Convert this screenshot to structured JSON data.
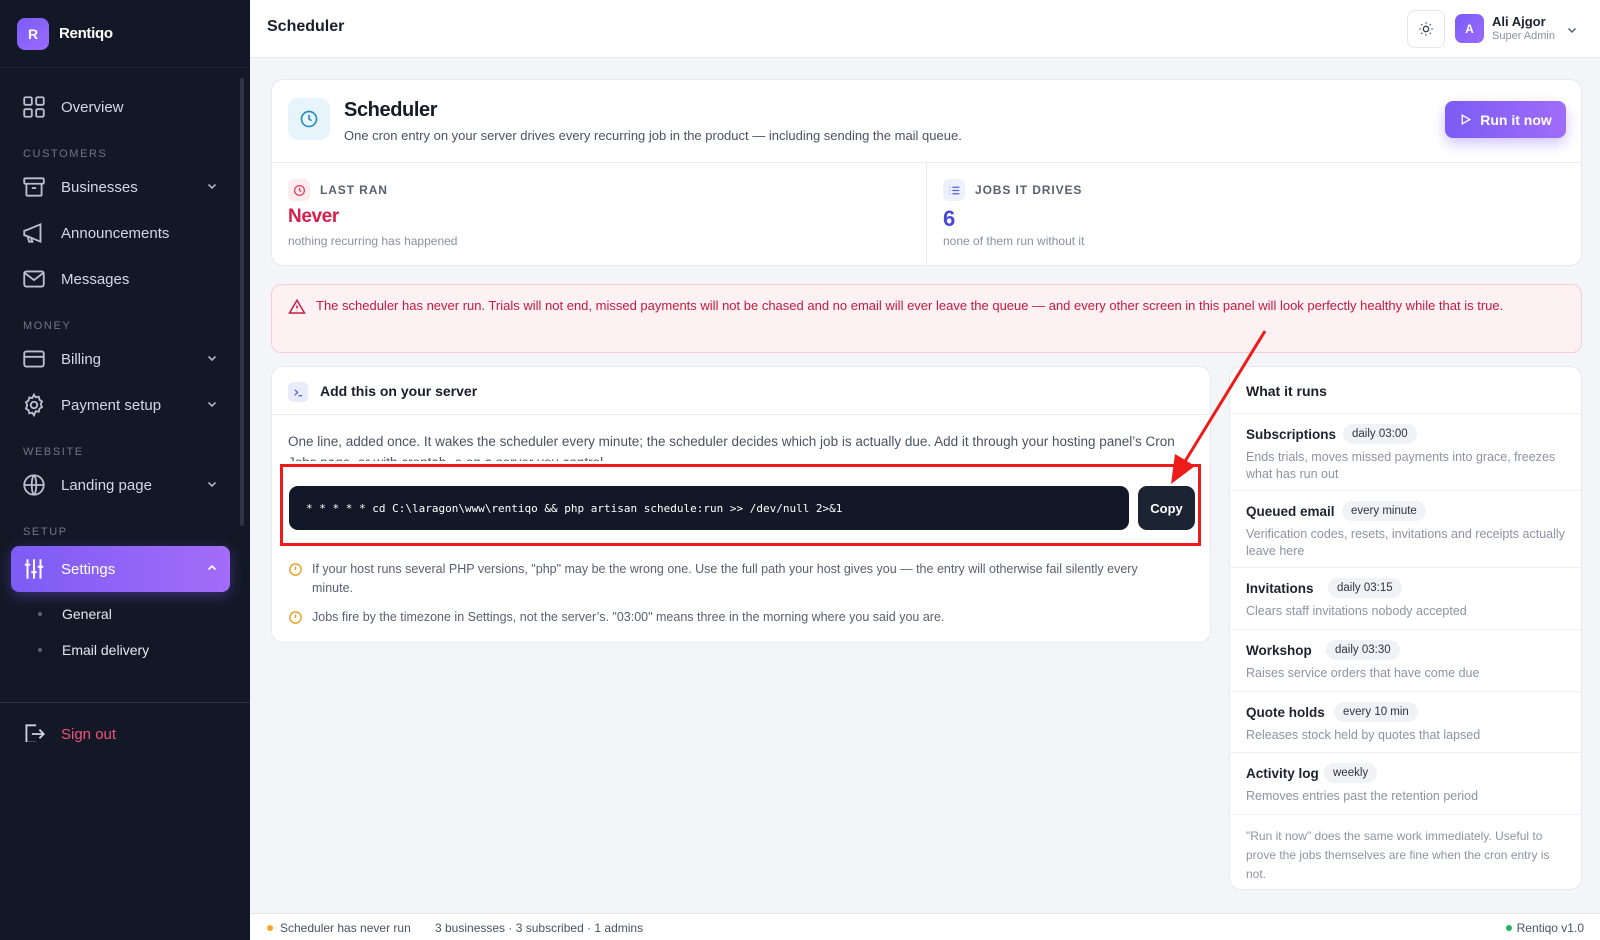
{
  "brand": {
    "logo_letter": "R",
    "name": "Rentiqo"
  },
  "sidebar": {
    "overview": "Overview",
    "sections": {
      "customers": "CUSTOMERS",
      "money": "MONEY",
      "website": "WEBSITE",
      "setup": "SETUP"
    },
    "items": {
      "businesses": "Businesses",
      "announcements": "Announcements",
      "messages": "Messages",
      "billing": "Billing",
      "payment_setup": "Payment setup",
      "landing_page": "Landing page",
      "settings": "Settings"
    },
    "settings_sub": [
      "General",
      "Email delivery"
    ],
    "sign_out": "Sign out"
  },
  "topbar": {
    "title": "Scheduler",
    "user": {
      "initial": "A",
      "name": "Ali Ajgor",
      "role": "Super Admin"
    }
  },
  "header": {
    "title": "Scheduler",
    "subtitle": "One cron entry on your server drives every recurring job in the product — including sending the mail queue.",
    "run_button": "Run it now"
  },
  "stats": {
    "last_ran": {
      "label": "LAST RAN",
      "value": "Never",
      "note": "nothing recurring has happened"
    },
    "jobs": {
      "label": "JOBS IT DRIVES",
      "value": "6",
      "note": "none of them run without it"
    }
  },
  "alert": "The scheduler has never run. Trials will not end, missed payments will not be chased and no email will ever leave the queue — and every other screen in this panel will look perfectly healthy while that is true.",
  "server": {
    "title": "Add this on your server",
    "description": "One line, added once. It wakes the scheduler every minute; the scheduler decides which job is actually due. Add it through your hosting panel’s Cron Jobs page, or with crontab -e on a server you control.",
    "command": "* * * * * cd C:\\laragon\\www\\rentiqo && php artisan schedule:run >> /dev/null 2>&1",
    "copy_label": "Copy",
    "tips": [
      "If your host runs several PHP versions, \"php\" may be the wrong one. Use the full path your host gives you — the entry will otherwise fail silently every minute.",
      "Jobs fire by the timezone in Settings, not the server’s. \"03:00\" means three in the morning where you said you are."
    ]
  },
  "runs": {
    "title": "What it runs",
    "items": [
      {
        "name": "Subscriptions",
        "schedule": "daily 03:00",
        "description": "Ends trials, moves missed payments into grace, freezes what has run out"
      },
      {
        "name": "Queued email",
        "schedule": "every minute",
        "description": "Verification codes, resets, invitations and receipts actually leave here"
      },
      {
        "name": "Invitations",
        "schedule": "daily 03:15",
        "description": "Clears staff invitations nobody accepted"
      },
      {
        "name": "Workshop",
        "schedule": "daily 03:30",
        "description": "Raises service orders that have come due"
      },
      {
        "name": "Quote holds",
        "schedule": "every 10 min",
        "description": "Releases stock held by quotes that lapsed"
      },
      {
        "name": "Activity log",
        "schedule": "weekly",
        "description": "Removes entries past the retention period"
      }
    ],
    "footnote": "\"Run it now\" does the same work immediately. Useful to prove the jobs themselves are fine when the cron entry is not."
  },
  "footer": {
    "status": "Scheduler has never run",
    "counts": "3 businesses · 3 subscribed · 1 admins",
    "version": "Rentiqo v1.0"
  },
  "colors": {
    "accent": "#7b5cf5",
    "danger": "#d61f4e",
    "sidebar_bg": "#131826",
    "annotation_red": "#ee1b1b",
    "status_warn": "#f5a623",
    "status_ok": "#22b35e"
  }
}
